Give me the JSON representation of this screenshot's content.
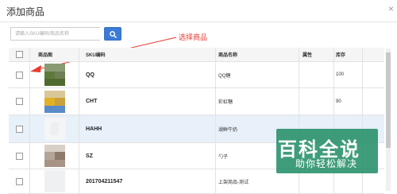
{
  "dialog": {
    "title": "添加商品",
    "close_glyph": "×"
  },
  "search": {
    "placeholder": "请输入SKU编码/商品名称",
    "button_icon": "search-icon"
  },
  "annotation": {
    "text": "选择商品",
    "color": "#e83b2f"
  },
  "table": {
    "headers": {
      "image": "商品图",
      "sku": "SKU编码",
      "name": "商品名称",
      "attr": "属性",
      "stock": "库存"
    },
    "rows": [
      {
        "sku": "QQ",
        "name": "QQ糖",
        "attr": "",
        "stock": "100"
      },
      {
        "sku": "CHT",
        "name": "彩虹糖",
        "attr": "",
        "stock": "90"
      },
      {
        "sku": "HAHH",
        "name": "湖鲜牛奶",
        "attr": "",
        "stock": ""
      },
      {
        "sku": "SZ",
        "name": "勺子",
        "attr": "",
        "stock": ""
      },
      {
        "sku": "201704211547",
        "name": "上架商品-测试",
        "attr": "",
        "stock": ""
      }
    ]
  },
  "watermark": {
    "logo": "百科全说",
    "subtitle": "助你轻松解决"
  },
  "colors": {
    "accent": "#3c7ad6",
    "selected_row": "#e8f0f9",
    "header_bg": "#f5f5f5"
  }
}
